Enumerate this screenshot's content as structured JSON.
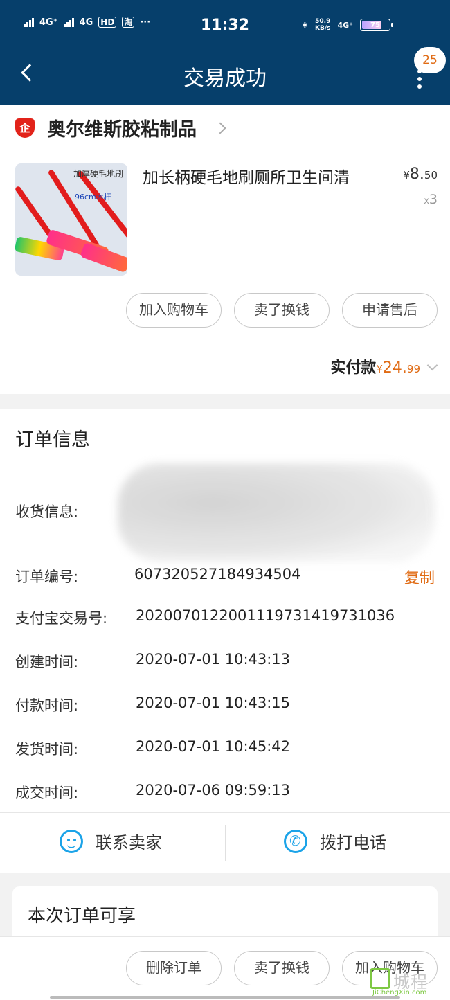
{
  "status_bar": {
    "network1": "4G⁺",
    "network2": "4G",
    "hd": "HD",
    "app_icon": "淘",
    "dots": "···",
    "time": "11:32",
    "bt_icon": "✱",
    "speed_value": "50.9",
    "speed_unit": "KB/s",
    "network3": "4G⁺",
    "battery": "75"
  },
  "nav": {
    "title": "交易成功",
    "badge_count": "25",
    "icons": [
      "back-icon",
      "more-icon"
    ]
  },
  "shop": {
    "logo_char": "企",
    "name": "奥尔维斯胶粘制品"
  },
  "product": {
    "image_label": "加厚硬毛地刷",
    "image_sublabel": "96cm木杆",
    "title": "加长柄硬毛地刷厕所卫生间清",
    "price_currency": "¥",
    "price_int": "8.",
    "price_dec": "50",
    "qty_prefix": "x",
    "qty": "3"
  },
  "item_actions": {
    "add_cart": "加入购物车",
    "resell": "卖了换钱",
    "after_sale": "申请售后"
  },
  "payment": {
    "label": "实付款",
    "currency": "¥",
    "amount_int": "24.",
    "amount_dec": "99"
  },
  "order_info": {
    "section_title": "订单信息",
    "receive_label": "收货信息:",
    "order_no_label": "订单编号:",
    "order_no": "607320527184934504",
    "copy_label": "复制",
    "alipay_label": "支付宝交易号:",
    "alipay_no": "2020070122001119731419731036",
    "created_label": "创建时间:",
    "created": "2020-07-01 10:43:13",
    "paid_label": "付款时间:",
    "paid": "2020-07-01 10:43:15",
    "shipped_label": "发货时间:",
    "shipped": "2020-07-01 10:45:42",
    "done_label": "成交时间:",
    "done": "2020-07-06 09:59:13"
  },
  "contact": {
    "seller": "联系卖家",
    "call": "拨打电话"
  },
  "benefits": {
    "title": "本次订单可享"
  },
  "bottom_actions": {
    "delete": "删除订单",
    "resell": "卖了换钱",
    "add_cart": "加入购物车"
  },
  "watermark": {
    "cn": "城程",
    "en": "JiChengXin.com"
  },
  "colors": {
    "header_bg": "#063f6b",
    "accent_orange": "#e06b14",
    "icon_blue": "#1ba3e8",
    "shop_red": "#e2231a"
  }
}
